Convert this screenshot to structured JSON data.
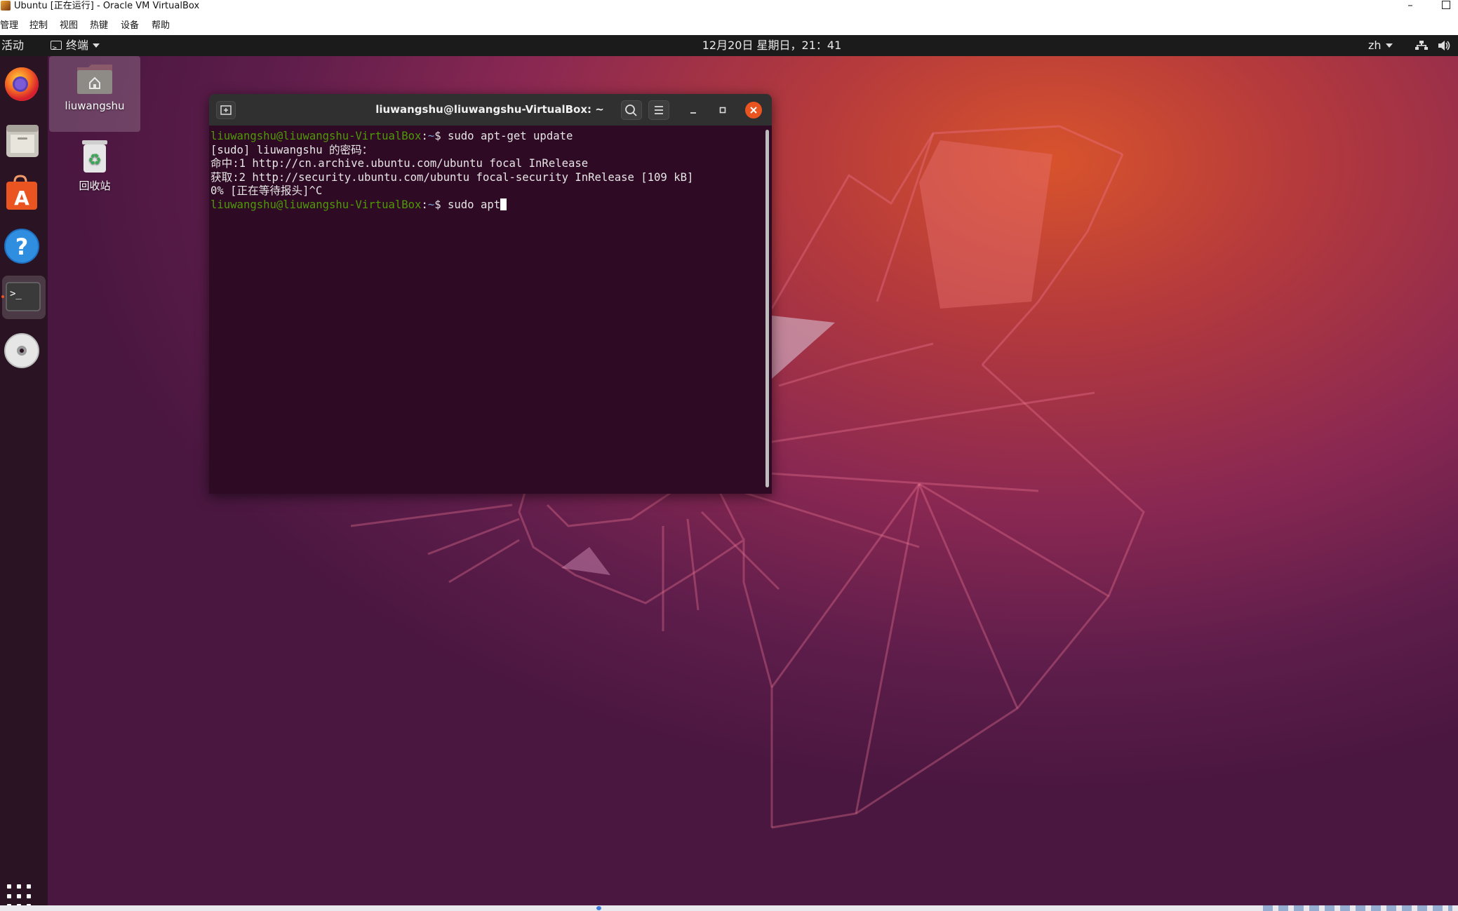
{
  "vbox": {
    "title": "Ubuntu [正在运行] - Oracle VM VirtualBox",
    "menu": [
      "管理",
      "控制",
      "视图",
      "热键",
      "设备",
      "帮助"
    ]
  },
  "topbar": {
    "activities": "活动",
    "app_menu": "终端",
    "clock": "12月20日 星期日，21：41",
    "language": "zh"
  },
  "dock": {
    "items": [
      {
        "icon": "firefox-icon",
        "active": false
      },
      {
        "icon": "files-icon",
        "active": false
      },
      {
        "icon": "software-icon",
        "active": false
      },
      {
        "icon": "help-icon",
        "active": false
      },
      {
        "icon": "terminal-icon",
        "active": true
      },
      {
        "icon": "disc-icon",
        "active": false
      }
    ],
    "show_apps_icon": "apps-grid-icon"
  },
  "desktop": {
    "icons": [
      {
        "label": "liuwangshu",
        "icon": "home-folder-icon"
      },
      {
        "label": "回收站",
        "icon": "trash-icon"
      }
    ]
  },
  "terminal": {
    "title": "liuwangshu@liuwangshu-VirtualBox: ~",
    "prompt_user": "liuwangshu@liuwangshu-VirtualBox",
    "prompt_sep": ":",
    "prompt_path": "~",
    "prompt_dollar": "$ ",
    "cmd1": "sudo apt-get update",
    "out1": "[sudo] liuwangshu 的密码：",
    "out2": "命中:1 http://cn.archive.ubuntu.com/ubuntu focal InRelease",
    "out3": "获取:2 http://security.ubuntu.com/ubuntu focal-security InRelease [109 kB]",
    "out4": "0% [正在等待报头]^C",
    "cmd2": "sudo apt"
  },
  "colors": {
    "ubuntu_orange": "#e95420",
    "terminal_bg": "#2f0a24",
    "prompt_green": "#4e9a06",
    "prompt_blue": "#729fcf"
  }
}
